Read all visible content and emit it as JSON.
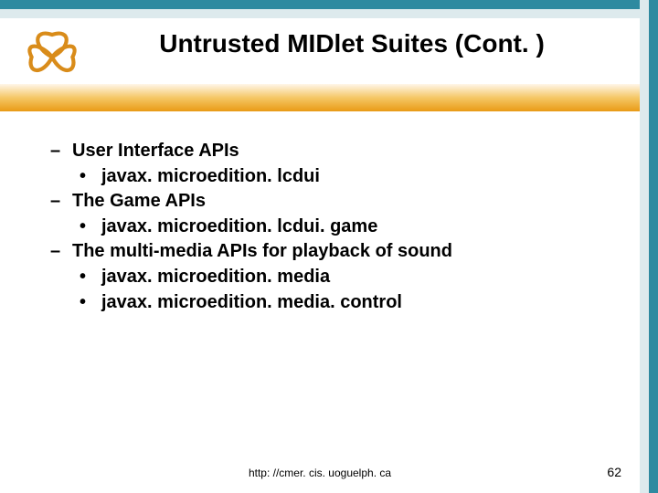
{
  "title": "Untrusted MIDlet Suites (Cont. )",
  "content": {
    "items": [
      {
        "level": "dash",
        "text": "User Interface APIs"
      },
      {
        "level": "bullet",
        "text": "javax. microedition. lcdui"
      },
      {
        "level": "dash",
        "text": "The Game APIs"
      },
      {
        "level": "bullet",
        "text": "javax. microedition. lcdui. game"
      },
      {
        "level": "dash",
        "text": "The multi-media APIs for playback of sound"
      },
      {
        "level": "bullet",
        "text": "javax. microedition. media"
      },
      {
        "level": "bullet",
        "text": "javax. microedition. media. control"
      }
    ]
  },
  "footer": {
    "url": "http: //cmer. cis. uoguelph. ca",
    "page": "62"
  },
  "colors": {
    "border": "#2e8aa0",
    "border_light": "#ddeaed",
    "band_dark": "#e99a16"
  }
}
